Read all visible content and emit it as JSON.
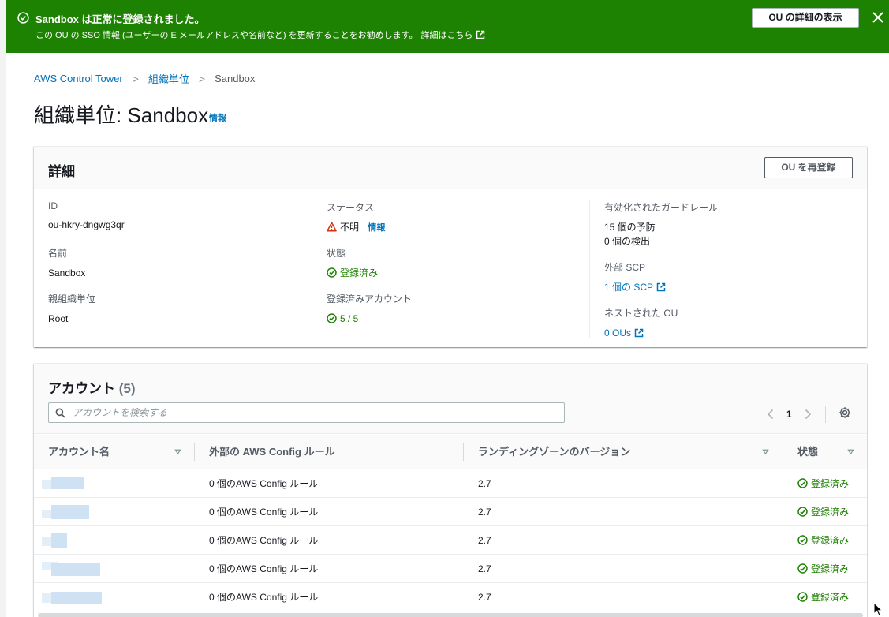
{
  "flash": {
    "title": "Sandbox は正常に登録されました。",
    "message": "この OU の SSO 情報 (ユーザーの E メールアドレスや名前など) を更新することをお勧めします。",
    "link": "詳細はこちら",
    "button": "OU の詳細の表示",
    "color": "#1d8102"
  },
  "breadcrumb": {
    "items": [
      "AWS Control Tower",
      "組織単位",
      "Sandbox"
    ]
  },
  "page": {
    "title": "組織単位: Sandbox",
    "info": "情報"
  },
  "details": {
    "heading": "詳細",
    "reregister_button": "OU を再登録",
    "id_label": "ID",
    "id_value": "ou-hkry-dngwg3qr",
    "name_label": "名前",
    "name_value": "Sandbox",
    "parent_label": "親組織単位",
    "parent_value": "Root",
    "status_label": "ステータス",
    "status_value": "不明",
    "status_info": "情報",
    "state_label": "状態",
    "state_value": "登録済み",
    "enrolled_label": "登録済みアカウント",
    "enrolled_value": "5 / 5",
    "guardrails_label": "有効化されたガードレール",
    "guardrails_preventive": "15 個の予防",
    "guardrails_detective": "0 個の検出",
    "scp_label": "外部 SCP",
    "scp_value": "1 個の SCP",
    "nested_label": "ネストされた OU",
    "nested_value": "0 OUs"
  },
  "accounts": {
    "heading": "アカウント",
    "count": "(5)",
    "search_placeholder": "アカウントを検索する",
    "page": "1",
    "columns": [
      "アカウント名",
      "外部の AWS Config ルール",
      "ランディングゾーンのバージョン",
      "状態"
    ],
    "rows": [
      {
        "rules": "0 個のAWS Config ルール",
        "version": "2.7",
        "state": "登録済み"
      },
      {
        "rules": "0 個のAWS Config ルール",
        "version": "2.7",
        "state": "登録済み"
      },
      {
        "rules": "0 個のAWS Config ルール",
        "version": "2.7",
        "state": "登録済み"
      },
      {
        "rules": "0 個のAWS Config ルール",
        "version": "2.7",
        "state": "登録済み"
      },
      {
        "rules": "0 個のAWS Config ルール",
        "version": "2.7",
        "state": "登録済み"
      }
    ]
  },
  "icons": {
    "success": "check-circle-icon",
    "warning": "warning-icon",
    "external": "external-link-icon",
    "search": "search-icon",
    "settings": "gear-icon",
    "close": "close-icon"
  }
}
